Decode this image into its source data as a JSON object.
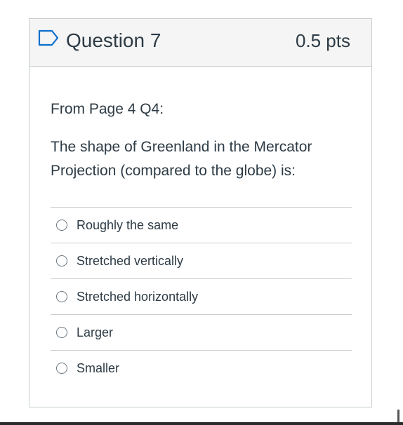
{
  "question": {
    "title": "Question 7",
    "points": "0.5 pts",
    "flag_icon": "bookmark-flag-icon",
    "source": "From Page 4 Q4:",
    "text": "The shape of Greenland in the Mercator Projection (compared to the globe) is:"
  },
  "answers": [
    {
      "label": "Roughly the same",
      "selected": false
    },
    {
      "label": "Stretched vertically",
      "selected": false
    },
    {
      "label": "Stretched horizontally",
      "selected": false
    },
    {
      "label": "Larger",
      "selected": false
    },
    {
      "label": "Smaller",
      "selected": false
    }
  ],
  "colors": {
    "text": "#2d3b45",
    "border": "#c7cdd1",
    "header_bg": "#f5f5f5",
    "flag": "#0b6fcc"
  }
}
